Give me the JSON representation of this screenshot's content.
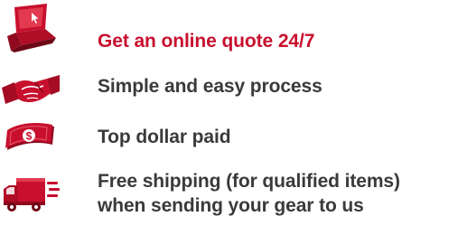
{
  "colors": {
    "accent": "#c8102e",
    "text": "#3a3a3a",
    "icon_red": "#c8102e"
  },
  "features": [
    {
      "icon": "laptop-icon",
      "text": "Get an online quote 24/7",
      "highlight": true
    },
    {
      "icon": "handshake-icon",
      "text": "Simple and easy process",
      "highlight": false
    },
    {
      "icon": "money-icon",
      "text": "Top dollar paid",
      "highlight": false
    },
    {
      "icon": "delivery-truck-icon",
      "lines": [
        "Free shipping (for qualified items)",
        "when sending your gear to us"
      ],
      "highlight": false
    }
  ]
}
